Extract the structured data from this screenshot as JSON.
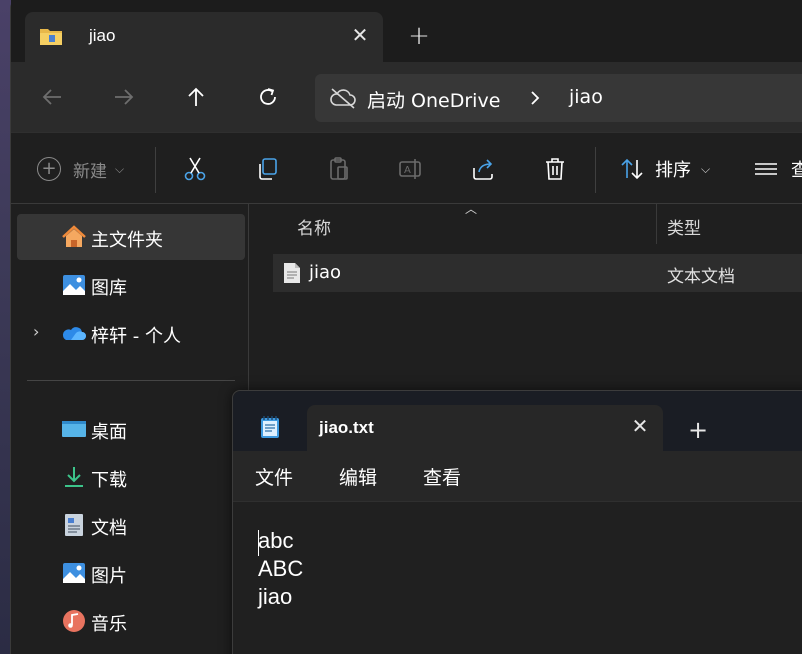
{
  "explorer": {
    "tab": {
      "title": "jiao",
      "icon": "folder-icon"
    },
    "breadcrumb": {
      "root": "启动 OneDrive",
      "current": "jiao"
    },
    "toolbar": {
      "new_label": "新建",
      "sort_label": "排序",
      "view_label": "查"
    },
    "sidebar": {
      "items": [
        {
          "label": "主文件夹",
          "icon": "home-icon"
        },
        {
          "label": "图库",
          "icon": "gallery-icon"
        },
        {
          "label": "梓轩 - 个人",
          "icon": "onedrive-cloud-icon"
        },
        {
          "label": "桌面",
          "icon": "desktop-icon"
        },
        {
          "label": "下载",
          "icon": "download-icon"
        },
        {
          "label": "文档",
          "icon": "documents-icon"
        },
        {
          "label": "图片",
          "icon": "pictures-icon"
        },
        {
          "label": "音乐",
          "icon": "music-icon"
        }
      ]
    },
    "columns": {
      "name": "名称",
      "type": "类型"
    },
    "files": [
      {
        "name": "jiao",
        "type": "文本文档"
      }
    ]
  },
  "notepad": {
    "tab_title": "jiao.txt",
    "menu": [
      "文件",
      "编辑",
      "查看"
    ],
    "content_lines": [
      "abc",
      "ABC",
      "jiao"
    ]
  }
}
